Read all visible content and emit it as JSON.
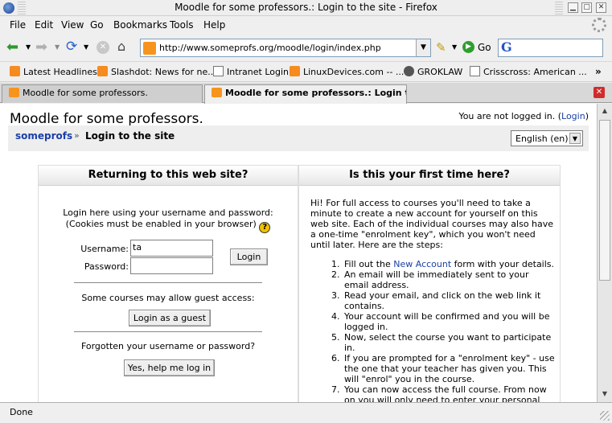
{
  "window": {
    "title": "Moodle for some professors.: Login to the site - Firefox"
  },
  "menu": [
    "File",
    "Edit",
    "View",
    "Go",
    "Bookmarks",
    "Tools",
    "Help"
  ],
  "nav": {
    "url": "http://www.someprofs.org/moodle/login/index.php",
    "go_label": "Go",
    "search_logo": "G"
  },
  "bookmarks": [
    {
      "label": "Latest Headlines",
      "icon": "rss-icon"
    },
    {
      "label": "Slashdot: News for ne...",
      "icon": "rss-icon"
    },
    {
      "label": "Intranet Login",
      "icon": "page-icon"
    },
    {
      "label": "LinuxDevices.com -- ...",
      "icon": "rss-icon"
    },
    {
      "label": "GROKLAW",
      "icon": "groklaw-icon"
    },
    {
      "label": "Crisscross: American ...",
      "icon": "page-icon"
    }
  ],
  "tabs": [
    {
      "label": "Moodle for some professors.",
      "active": false
    },
    {
      "label": "Moodle for some professors.: Login to ...",
      "active": true
    }
  ],
  "page": {
    "site_title": "Moodle for some professors.",
    "login_status_prefix": "You are not logged in. (",
    "login_link": "Login",
    "login_status_suffix": ")",
    "breadcrumb_home": "someprofs",
    "breadcrumb_sep": "»",
    "breadcrumb_current": "Login to the site",
    "language": "English (en)"
  },
  "login_panel": {
    "heading": "Returning to this web site?",
    "intro_line1": "Login here using your username and password:",
    "intro_line2": "(Cookies must be enabled in your browser)",
    "username_label": "Username:",
    "username_value": "ta",
    "password_label": "Password:",
    "password_value": "",
    "login_button": "Login",
    "guest_text": "Some courses may allow guest access:",
    "guest_button": "Login as a guest",
    "forgot_text": "Forgotten your username or password?",
    "forgot_button": "Yes, help me log in"
  },
  "signup_panel": {
    "heading": "Is this your first time here?",
    "intro": "Hi! For full access to courses you'll need to take a minute to create a new account for yourself on this web site. Each of the individual courses may also have a one-time \"enrolment key\", which you won't need until later. Here are the steps:",
    "steps": [
      {
        "num": "1.",
        "pre": "Fill out the ",
        "link": "New Account",
        "post": " form with your details."
      },
      {
        "num": "2.",
        "pre": "An email will be immediately sent to your email address.",
        "link": "",
        "post": ""
      },
      {
        "num": "3.",
        "pre": "Read your email, and click on the web link it contains.",
        "link": "",
        "post": ""
      },
      {
        "num": "4.",
        "pre": "Your account will be confirmed and you will be logged in.",
        "link": "",
        "post": ""
      },
      {
        "num": "5.",
        "pre": "Now, select the course you want to participate in.",
        "link": "",
        "post": ""
      },
      {
        "num": "6.",
        "pre": "If you are prompted for a \"enrolment key\" - use the one that your teacher has given you. This will \"enrol\" you in the course.",
        "link": "",
        "post": ""
      },
      {
        "num": "7.",
        "pre": "You can now access the full course. From now on you will only need to enter your personal username and password (in the form on this",
        "link": "",
        "post": ""
      }
    ]
  },
  "status_text": "Done"
}
